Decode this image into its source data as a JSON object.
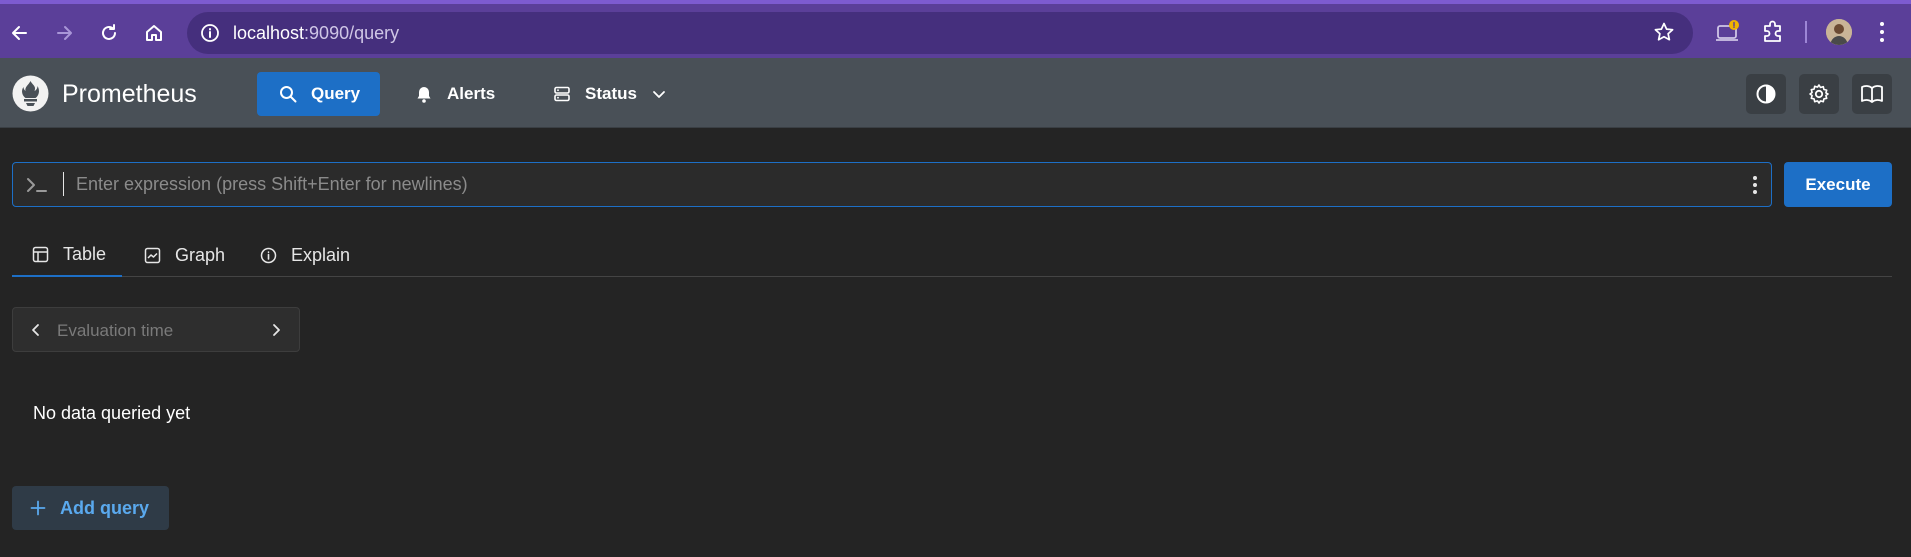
{
  "browser": {
    "url_host": "localhost",
    "url_path": ":9090/query"
  },
  "app": {
    "brand": "Prometheus",
    "nav": {
      "query": "Query",
      "alerts": "Alerts",
      "status": "Status"
    }
  },
  "expression": {
    "placeholder": "Enter expression (press Shift+Enter for newlines)",
    "value": "",
    "execute_label": "Execute"
  },
  "tabs": [
    {
      "label": "Table",
      "active": true
    },
    {
      "label": "Graph",
      "active": false
    },
    {
      "label": "Explain",
      "active": false
    }
  ],
  "eval_time": {
    "placeholder": "Evaluation time"
  },
  "results": {
    "empty_message": "No data queried yet"
  },
  "add_query_label": "Add query",
  "colors": {
    "browser_frame": "#5b3f99",
    "navbar": "#495057",
    "accent": "#1d6fc6",
    "background": "#242424"
  }
}
